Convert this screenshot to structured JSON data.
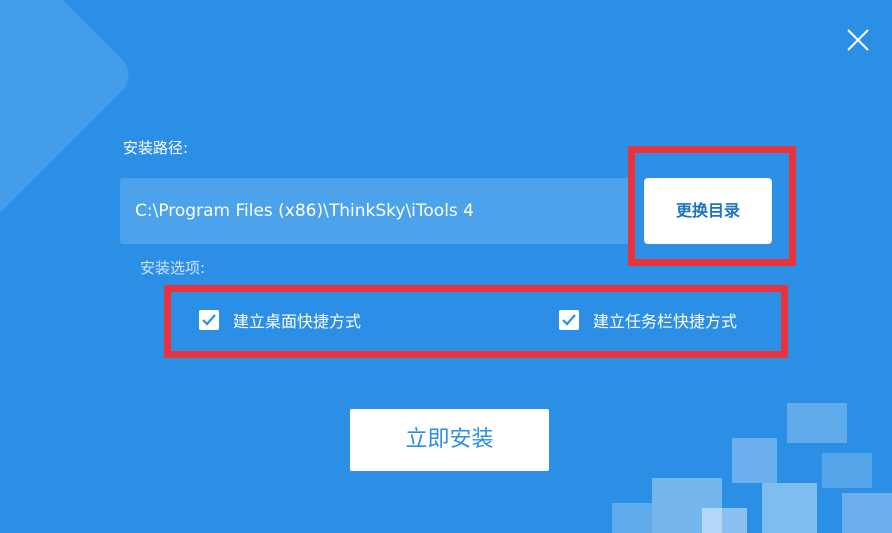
{
  "window": {
    "background_color": "#2b8fe6",
    "close_icon": "close-icon"
  },
  "install_path": {
    "label": "安装路径:",
    "value": "C:\\Program Files (x86)\\ThinkSky\\iTools 4",
    "change_button_label": "更换目录"
  },
  "install_options": {
    "label": "安装选项:",
    "items": [
      {
        "label": "建立桌面快捷方式",
        "checked": true
      },
      {
        "label": "建立任务栏快捷方式",
        "checked": true
      }
    ]
  },
  "install_button": {
    "label": "立即安装"
  },
  "annotation": {
    "color": "#e8323c"
  }
}
